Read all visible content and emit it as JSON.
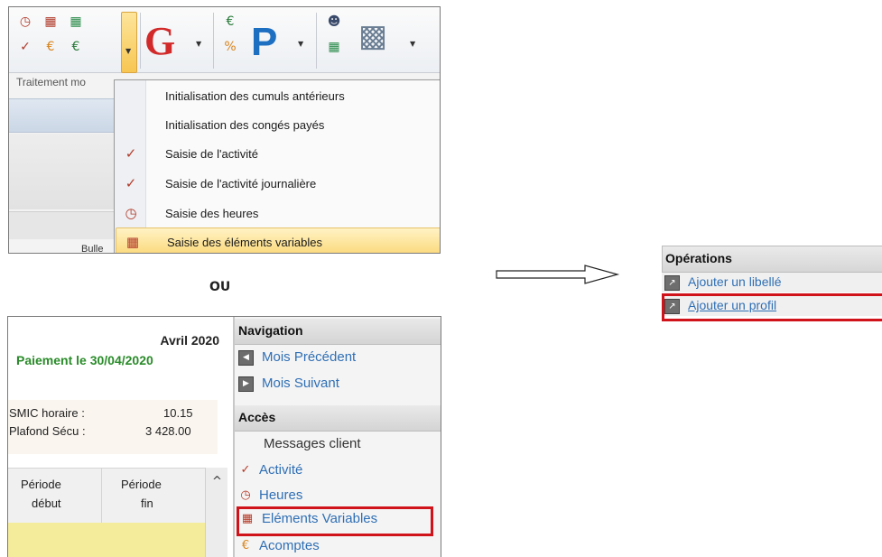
{
  "ribbon": {
    "group_label": "Traitement mo",
    "bulle_label": "Bulle",
    "big_icons": [
      "G",
      "P"
    ]
  },
  "menu": {
    "items": [
      {
        "label": "Initialisation des cumuls antérieurs",
        "icon": "none"
      },
      {
        "label": "Initialisation des congés payés",
        "icon": "none"
      },
      {
        "label": "Saisie de l'activité",
        "icon": "activity-icon"
      },
      {
        "label": "Saisie de l'activité journalière",
        "icon": "daily-activity-icon"
      },
      {
        "label": "Saisie des heures",
        "icon": "clock-icon"
      },
      {
        "label": "Saisie des éléments variables",
        "icon": "variables-icon",
        "highlighted": true
      }
    ]
  },
  "separator_text": "OU",
  "operations": {
    "title": "Opérations",
    "items": [
      {
        "label": "Ajouter un libellé"
      },
      {
        "label": "Ajouter un profil",
        "highlighted": true
      }
    ]
  },
  "payroll": {
    "month": "Avril 2020",
    "payment": "Paiement le 30/04/2020",
    "smic_label": "SMIC horaire :",
    "smic_value": "10.15",
    "plafond_label": "Plafond Sécu :",
    "plafond_value": "3 428.00",
    "col1_line1": "Période",
    "col1_line2": "début",
    "col2_line1": "Période",
    "col2_line2": "fin",
    "scroll_up": "^"
  },
  "navigation": {
    "title": "Navigation",
    "prev": "Mois Précédent",
    "next": "Mois Suivant"
  },
  "acces": {
    "title": "Accès",
    "messages": "Messages client",
    "activite": "Activité",
    "heures": "Heures",
    "elements": "Eléments Variables",
    "acomptes": "Acomptes"
  },
  "colors": {
    "highlight_red": "#d0121b",
    "link_blue": "#2f6fb5",
    "payment_green": "#2a8b2a",
    "menu_highlight": "#fbd97a"
  }
}
